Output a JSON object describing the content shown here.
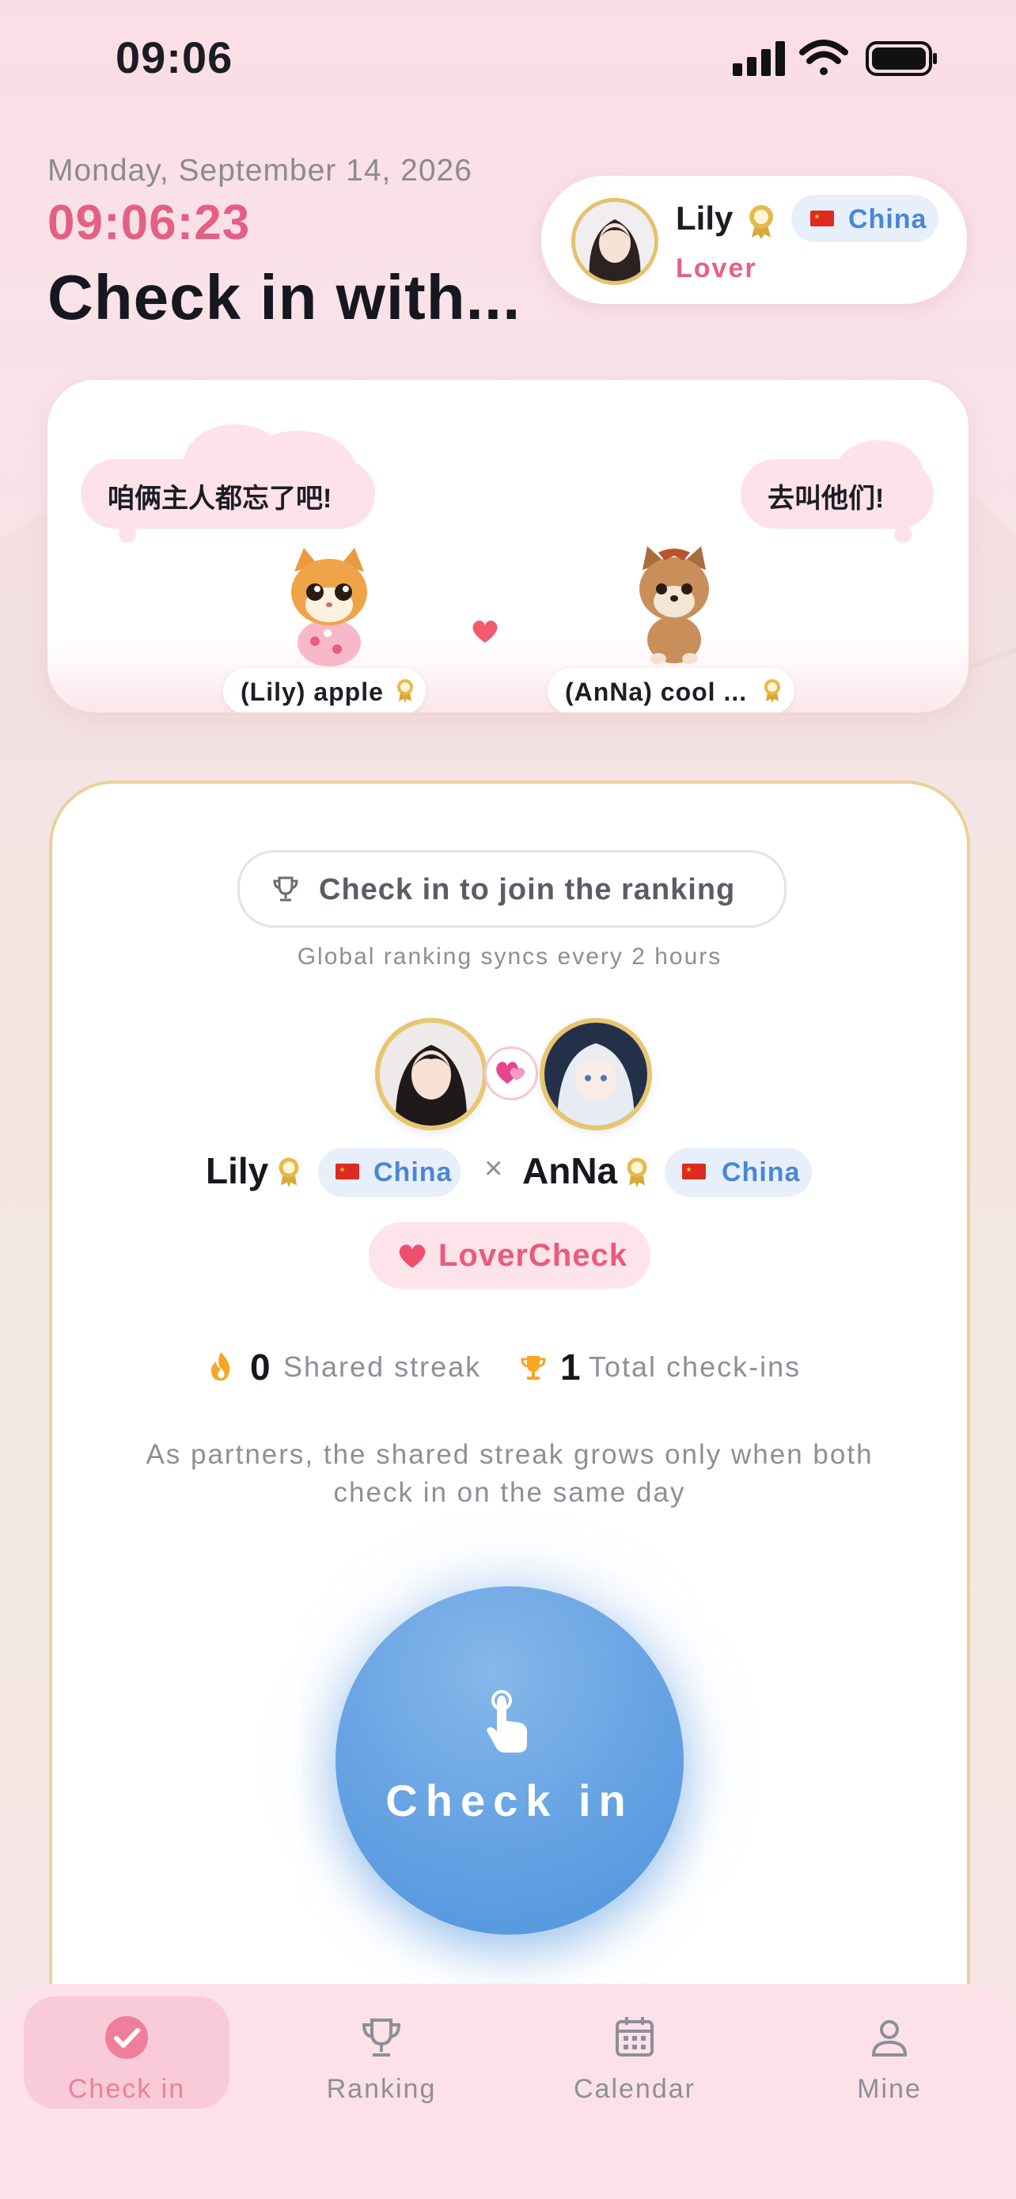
{
  "status_bar": {
    "time": "09:06"
  },
  "header": {
    "date": "Monday, September 14, 2026",
    "clock": "09:06:23",
    "headline": "Check in with..."
  },
  "profile": {
    "name": "Lily",
    "country": "China",
    "role": "Lover"
  },
  "pets": {
    "left_bubble": "咱俩主人都忘了吧!",
    "right_bubble": "去叫他们!",
    "left_label": "(Lily) apple",
    "right_label": "(AnNa) cool ..."
  },
  "main": {
    "ranking_pill": "Check in to join the ranking",
    "sync_note": "Global ranking syncs every 2 hours",
    "user1": {
      "name": "Lily",
      "country": "China"
    },
    "separator": "×",
    "user2": {
      "name": "AnNa",
      "country": "China"
    },
    "badge": "LoverCheck",
    "stats": {
      "streak_value": "0",
      "streak_label": "Shared streak",
      "total_value": "1",
      "total_label": "Total check-ins"
    },
    "note": "As partners, the shared streak grows only when both check in on the same day",
    "checkin_label": "Check in"
  },
  "tabbar": {
    "tabs": [
      {
        "label": "Check in",
        "icon": "check-circle-icon",
        "active": true
      },
      {
        "label": "Ranking",
        "icon": "trophy-icon",
        "active": false
      },
      {
        "label": "Calendar",
        "icon": "calendar-icon",
        "active": false
      },
      {
        "label": "Mine",
        "icon": "person-icon",
        "active": false
      }
    ]
  },
  "colors": {
    "accent_pink": "#e35f86",
    "accent_blue": "#4e93dc",
    "gold": "#e6c06c"
  }
}
